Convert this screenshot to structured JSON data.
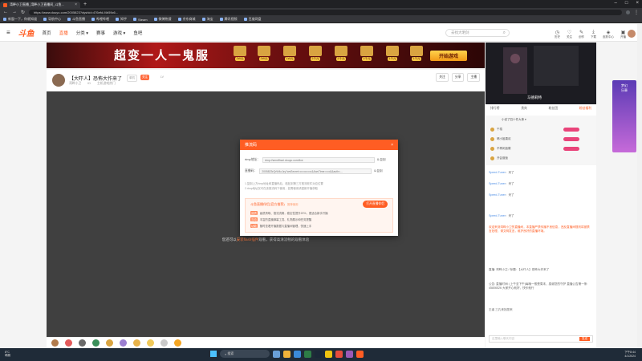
{
  "browser": {
    "tab_title": "湾畔小卫直播_湾畔小卫直播间_斗鱼...",
    "url": "https://www.douyu.com/2005823?dyshid=476efd-f4b59c6..."
  },
  "bookmarks": [
    "新窗一下，你就知道",
    "导航中心",
    "斗鱼直播",
    "哔哩哔哩",
    "知乎",
    "Steam",
    "微博热搜",
    "京东商城",
    "淘宝",
    "腾讯视频",
    "百度网盘"
  ],
  "site": {
    "logo": "斗鱼",
    "nav": [
      "首页",
      "直播",
      "分类 ▾",
      "赛事",
      "游戏 ▾",
      "鱼吧"
    ],
    "search_placeholder": "去找大明剑",
    "header_icons": [
      "历史",
      "关注",
      "创作",
      "下载",
      "皮肤中心",
      "开播"
    ]
  },
  "banner": {
    "title": "超变一人一鬼服",
    "prizes": [
      "2W元",
      "2W元",
      "1W元",
      "2千元",
      "2千元",
      "2千元",
      "1千元",
      "1千元"
    ],
    "start_button": "开始游戏"
  },
  "streamer": {
    "title": "【大吓人】恐怖大作来了",
    "tags": [
      "单机",
      "关注",
      "LV"
    ],
    "sub": [
      "湾畔小卫",
      "ID",
      "主机游戏热门"
    ],
    "buttons": [
      "关注",
      "分享",
      "主播"
    ]
  },
  "modal": {
    "title": "推流码",
    "rtmp_label": "rtmp地址：",
    "rtmp_value": "rtmp://sendfhwri.douyu.com/live",
    "stream_label": "直播码：",
    "stream_value": "2005823rQrW4cJzy?wsSecret=••••••••••••&&wsTime=••••&&auth=...",
    "copy_label": "复制",
    "tips": [
      "1.复制上方rtmp地址和直播码后，粘贴到第三方推流软件对应位置",
      "2.rtmp地址仅可在该推流码下使用，如需使用请重新开播获取"
    ],
    "promo_title": "斗鱼直播伴侣(官方推荐)",
    "promo_tag": "推荐使用",
    "promo_button": "打开直播伴侣",
    "perks": [
      {
        "tag": "品质",
        "text": "画质清晰、推流流畅，稳定性提升20%，更适合新手开播"
      },
      {
        "tag": "互动",
        "text": "丰富的直播弹幕工具、礼物展示和任务提醒"
      },
      {
        "tag": "功能",
        "text": "随时查看开播数据与直播间管理，快速上手"
      }
    ],
    "close_icon": "close-icon"
  },
  "player": {
    "flash_msg_prefix": "您还可以",
    "flash_msg_link": "安装flash插件",
    "flash_msg_suffix": "观看，获得高清流畅的观看体验"
  },
  "right": {
    "preview_name": "马德莉特",
    "tabs": [
      "排行榜",
      "贵宾",
      "粉丝团",
      "粉丝福利"
    ],
    "active_tab": "粉丝福利",
    "rank_head": "小说了四十件大事 ▾",
    "rank": [
      "千禧",
      "晴小姐喜欢",
      "不再闲适寡",
      "开会饿饭"
    ],
    "messages": [
      {
        "user": "Speed-Tuner",
        "text": "来了"
      },
      {
        "user": "Speed-Tuner",
        "text": "来了"
      },
      {
        "user": "Speed-Tuner",
        "text": "来了"
      },
      {
        "user": "Speed-Tuner",
        "text": "来了"
      }
    ],
    "notice": "欢迎来到湾畔小卫的直播间，本直播严禁传播不良信息，违反直播间规则将被禁言处理，请文明发言，维护良好的直播环境。",
    "notice2": "直播: 湾畔小卫 / 标题: 【大吓人】恐怖大作来了",
    "notice3": "公告: 直播时间: (上午至下午)每晚一般是周末，感谢您的守护 直播公告第一条: 45806526 大家开心就好，快乐就行",
    "follower": "王者 三孔来找您来",
    "input_placeholder": "这里输入聊天内容",
    "send_label": "发送"
  },
  "sidead": {
    "line1": "梦幻",
    "line2": "乐章"
  },
  "taskbar": {
    "weather_temp": "8°C",
    "weather_desc": "晴朗",
    "search": "搜索",
    "time": "下午8:44",
    "date": "4/1/2024"
  }
}
